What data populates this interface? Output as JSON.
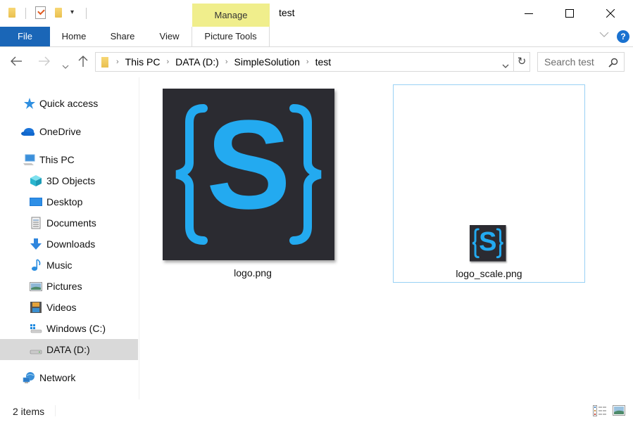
{
  "window": {
    "title": "test",
    "contextual_group": "Manage",
    "controls": {
      "minimize": "minimize",
      "maximize": "maximize",
      "close": "close"
    }
  },
  "quick_access_toolbar": {
    "icons": [
      "folder-icon",
      "properties-icon",
      "new-folder-icon",
      "customize-dropdown-icon"
    ],
    "dropdown_glyph": "▾"
  },
  "ribbon": {
    "tabs": [
      {
        "label": "File",
        "active": true
      },
      {
        "label": "Home"
      },
      {
        "label": "Share"
      },
      {
        "label": "View"
      },
      {
        "label": "Picture Tools"
      }
    ],
    "help_label": "?",
    "collapse_glyph": "⌄"
  },
  "navigation": {
    "back": "←",
    "forward": "→",
    "recent": "⌄",
    "up": "↑",
    "breadcrumb": [
      "This PC",
      "DATA (D:)",
      "SimpleSolution",
      "test"
    ],
    "separator": "›",
    "address_dropdown": "⌄",
    "refresh": "↻",
    "search_placeholder": "Search test",
    "search_glyph": "⚲"
  },
  "sidebar": {
    "items": [
      {
        "label": "Quick access",
        "icon": "quick-access-star-icon"
      },
      {
        "label": "OneDrive",
        "icon": "onedrive-cloud-icon"
      },
      {
        "label": "This PC",
        "icon": "this-pc-icon"
      },
      {
        "label": "3D Objects",
        "icon": "3d-objects-icon"
      },
      {
        "label": "Desktop",
        "icon": "desktop-icon"
      },
      {
        "label": "Documents",
        "icon": "documents-icon"
      },
      {
        "label": "Downloads",
        "icon": "downloads-icon"
      },
      {
        "label": "Music",
        "icon": "music-icon"
      },
      {
        "label": "Pictures",
        "icon": "pictures-icon"
      },
      {
        "label": "Videos",
        "icon": "videos-icon"
      },
      {
        "label": "Windows (C:)",
        "icon": "windows-drive-icon"
      },
      {
        "label": "DATA (D:)",
        "icon": "data-drive-icon",
        "selected": true
      },
      {
        "label": "Network",
        "icon": "network-icon"
      }
    ]
  },
  "files": [
    {
      "name": "logo.png",
      "thumbnail": "logo-thumbnail",
      "selected": false
    },
    {
      "name": "logo_scale.png",
      "thumbnail": "logo-small-thumbnail",
      "selected": true
    }
  ],
  "logo": {
    "letter": "S",
    "bg_color": "#2b2b31",
    "fg_color": "#23aaf0"
  },
  "status": {
    "item_count": "2 items",
    "views": [
      "details-view-icon",
      "large-icons-view-icon"
    ]
  },
  "colors": {
    "file_tab": "#1a66b7",
    "manage_tab": "#f0ee8c",
    "selected_item": "#d9d9d9",
    "selection_border": "#99d1f5"
  }
}
